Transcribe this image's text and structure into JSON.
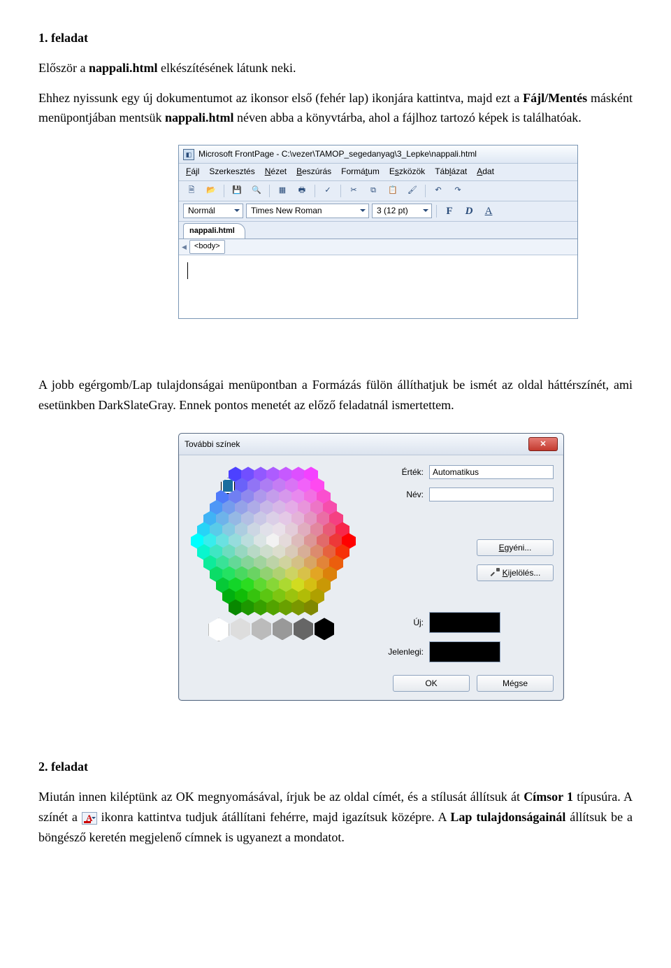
{
  "task1": {
    "heading": "1. feladat",
    "p1_a": "Először a ",
    "p1_b": "nappali.html",
    "p1_c": " elkészítésének látunk neki.",
    "p2_a": "Ehhez nyissunk egy új dokumentumot az ikonsor első (fehér lap) ikonjára kattintva, majd ezt a ",
    "p2_b": "Fájl/Mentés",
    "p2_c": " másként menüpontjában mentsük ",
    "p2_d": "nappali.html",
    "p2_e": " néven abba a könyvtárba, ahol a fájlhoz tartozó képek is találhatóak."
  },
  "fp": {
    "title": "Microsoft FrontPage - C:\\vezer\\TAMOP_segedanyag\\3_Lepke\\nappali.html",
    "menu": [
      "Fájl",
      "Szerkesztés",
      "Nézet",
      "Beszúrás",
      "Formátum",
      "Eszközök",
      "Táblázat",
      "Adat"
    ],
    "style_label": "Normál",
    "font_label": "Times New Roman",
    "size_label": "3 (12 pt)",
    "fmt_f": "F",
    "fmt_d": "D",
    "fmt_a": "A",
    "tab": "nappali.html",
    "crumb": "<body>"
  },
  "mid": {
    "p": "A jobb egérgomb/Lap tulajdonságai menüpontban a Formázás fülön állíthatjuk be ismét az oldal háttérszínét, ami esetünkben DarkSlateGray. Ennek pontos menetét az előző feladatnál ismertettem."
  },
  "dlg": {
    "title": "További színek",
    "ertek_label": "Érték:",
    "ertek_value": "Automatikus",
    "nev_label": "Név:",
    "nev_value": "",
    "egyeni": "Egyéni...",
    "kijeloles": "Kijelölés...",
    "uj": "Új:",
    "jelenlegi": "Jelenlegi:",
    "ok": "OK",
    "megse": "Mégse"
  },
  "task2": {
    "heading": "2. feladat",
    "p_a": "Miután innen kiléptünk az OK megnyomásával, írjuk be az oldal címét, és a stílusát állítsuk át ",
    "p_b": "Címsor 1",
    "p_c": " típusúra. A színét a ",
    "p_d": " ikonra kattintva tudjuk átállítani fehérre, majd igazítsuk középre. A ",
    "p_e": "Lap tulajdonságainál",
    "p_f": " állítsuk be a böngésző keretén megjelenő címnek is ugyanezt a mondatot."
  }
}
